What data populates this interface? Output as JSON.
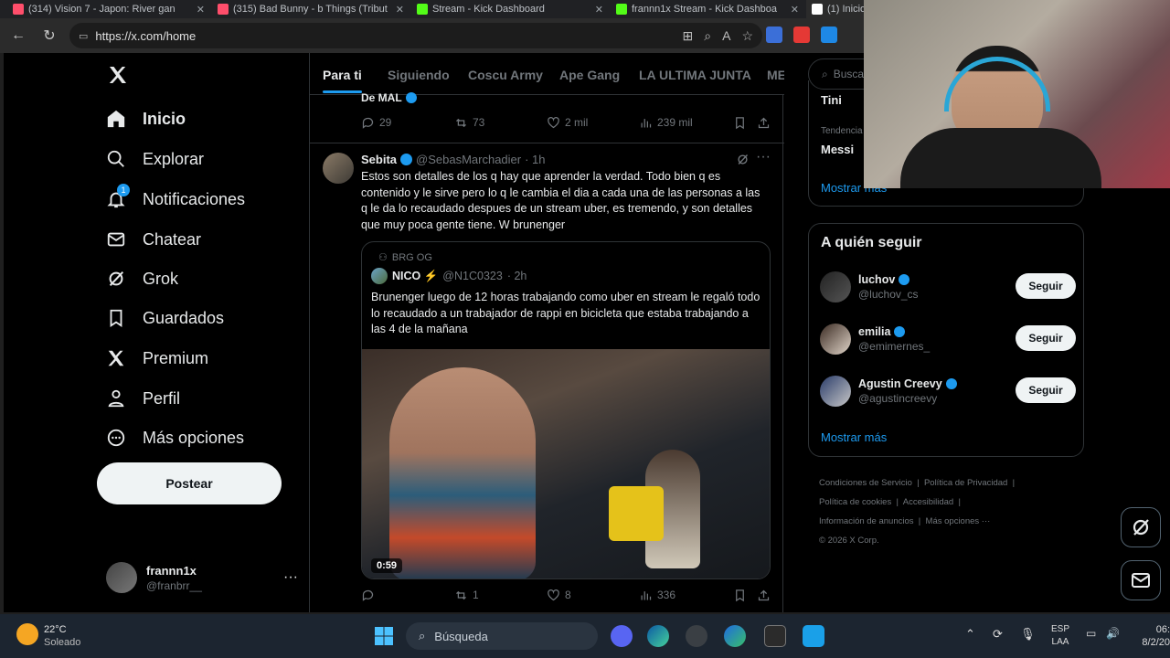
{
  "browser": {
    "tabs": [
      {
        "title": "(314) Vision 7 - Japon: River gan",
        "color": "#ff4e6b"
      },
      {
        "title": "(315) Bad Bunny - b Things (Tribut",
        "color": "#ff4e6b"
      },
      {
        "title": "Stream - Kick Dashboard",
        "color": "#53fc18"
      },
      {
        "title": "frannn1x Stream - Kick Dashboa",
        "color": "#53fc18"
      },
      {
        "title": "(1) Inicio",
        "color": "#ffffff"
      }
    ],
    "url": "https://x.com/home"
  },
  "nav": {
    "items": [
      {
        "label": "Inicio",
        "icon": "home-icon"
      },
      {
        "label": "Explorar",
        "icon": "search-icon"
      },
      {
        "label": "Notificaciones",
        "icon": "bell-icon",
        "badge": "1"
      },
      {
        "label": "Chatear",
        "icon": "mail-icon"
      },
      {
        "label": "Grok",
        "icon": "grok-icon"
      },
      {
        "label": "Guardados",
        "icon": "bookmark-icon"
      },
      {
        "label": "Premium",
        "icon": "x-logo-icon"
      },
      {
        "label": "Perfil",
        "icon": "person-icon"
      },
      {
        "label": "Más opciones",
        "icon": "more-circle-icon"
      }
    ],
    "post_button": "Postear",
    "account": {
      "name": "frannn1x",
      "handle": "@franbrr__"
    }
  },
  "feed": {
    "tabs": [
      "Para ti",
      "Siguiendo",
      "Coscu Army",
      "Ape Gang",
      "LA ULTIMA JUNTA",
      "ME"
    ],
    "prev_fragment": "De MAL",
    "prev_actions": {
      "replies": "29",
      "reposts": "73",
      "likes": "2 mil",
      "views": "239 mil"
    },
    "tweet": {
      "name": "Sebita",
      "handle": "@SebasMarchadier",
      "time": "· 1h",
      "text": "Estos son detalles de los q hay que aprender la verdad. Todo bien q es contenido y le sirve pero lo q le cambia el dia a cada una de las personas a las q le da lo recaudado despues de un stream uber, es tremendo, y son detalles que muy poca gente tiene. W brunenger",
      "quote": {
        "community": "BRG OG",
        "name": "NICO ⚡",
        "handle": "@N1C0323",
        "time": "· 2h",
        "text": "Brunenger luego de 12 horas trabajando como uber en stream le regaló todo lo recaudado a un trabajador de rappi en bicicleta que estaba trabajando a las 4 de la mañana",
        "video_duration": "0:59"
      },
      "actions": {
        "replies": "",
        "reposts": "1",
        "likes": "8",
        "views": "336"
      }
    }
  },
  "right": {
    "search_placeholder": "Buscar",
    "trends": [
      {
        "category": "",
        "name": "Tini"
      },
      {
        "category": "Tendencia",
        "name": "Messi"
      }
    ],
    "trends_more": "Mostrar más",
    "who_to_follow": {
      "title": "A quién seguir",
      "users": [
        {
          "name": "luchov",
          "handle": "@luchov_cs",
          "button": "Seguir"
        },
        {
          "name": "emilia",
          "handle": "@emimernes_",
          "button": "Seguir"
        },
        {
          "name": "Agustin Creevy",
          "handle": "@agustincreevy",
          "button": "Seguir"
        }
      ],
      "more": "Mostrar más"
    },
    "footer": [
      "Condiciones de Servicio",
      "Política de Privacidad",
      "Política de cookies",
      "Accesibilidad",
      "Información de anuncios",
      "Más opciones ···",
      "© 2026 X Corp."
    ]
  },
  "taskbar": {
    "weather_temp": "22°C",
    "weather_desc": "Soleado",
    "search": "Búsqueda",
    "lang_top": "ESP",
    "lang_bottom": "LAA",
    "time": "06:",
    "date": "8/2/20"
  },
  "colors": {
    "accent": "#1d9bf0",
    "background": "#000000",
    "verified": "#1d9bf0"
  }
}
